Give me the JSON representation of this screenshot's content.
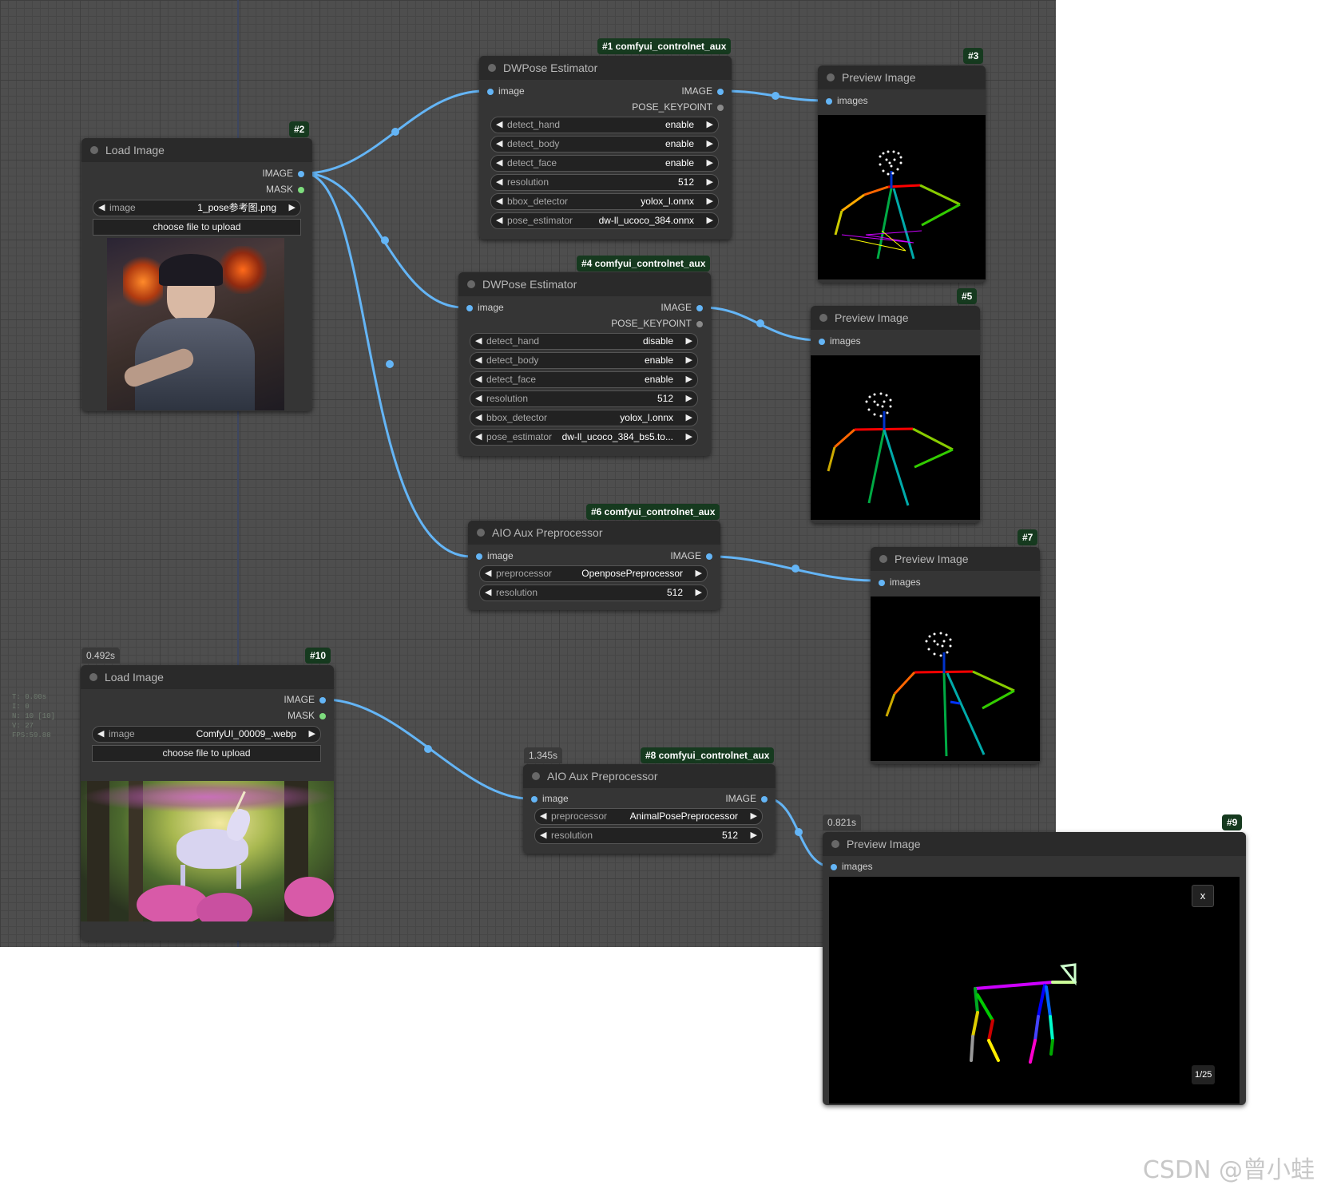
{
  "stats": {
    "t": "T: 0.00s",
    "i": "I: 0",
    "n": "N: 10 [10]",
    "v": "V: 27",
    "fps": "FPS:59.88"
  },
  "nodes": {
    "n1": {
      "badge": "#1 comfyui_controlnet_aux",
      "title": "DWPose Estimator",
      "input": "image",
      "out_image": "IMAGE",
      "out_pose": "POSE_KEYPOINT",
      "widgets": [
        {
          "label": "detect_hand",
          "value": "enable"
        },
        {
          "label": "detect_body",
          "value": "enable"
        },
        {
          "label": "detect_face",
          "value": "enable"
        },
        {
          "label": "resolution",
          "value": "512"
        },
        {
          "label": "bbox_detector",
          "value": "yolox_l.onnx"
        },
        {
          "label": "pose_estimator",
          "value": "dw-ll_ucoco_384.onnx"
        }
      ]
    },
    "n2": {
      "badge": "#2",
      "title": "Load Image",
      "out_image": "IMAGE",
      "out_mask": "MASK",
      "widget": {
        "label": "image",
        "value": "1_pose参考图.png"
      },
      "upload": "choose file to upload"
    },
    "n3": {
      "badge": "#3",
      "title": "Preview Image",
      "input": "images"
    },
    "n4": {
      "badge": "#4 comfyui_controlnet_aux",
      "title": "DWPose Estimator",
      "input": "image",
      "out_image": "IMAGE",
      "out_pose": "POSE_KEYPOINT",
      "widgets": [
        {
          "label": "detect_hand",
          "value": "disable"
        },
        {
          "label": "detect_body",
          "value": "enable"
        },
        {
          "label": "detect_face",
          "value": "enable"
        },
        {
          "label": "resolution",
          "value": "512"
        },
        {
          "label": "bbox_detector",
          "value": "yolox_l.onnx"
        },
        {
          "label": "pose_estimator",
          "value": "dw-ll_ucoco_384_bs5.to..."
        }
      ]
    },
    "n5": {
      "badge": "#5",
      "title": "Preview Image",
      "input": "images"
    },
    "n6": {
      "badge": "#6 comfyui_controlnet_aux",
      "title": "AIO Aux Preprocessor",
      "input": "image",
      "out_image": "IMAGE",
      "widgets": [
        {
          "label": "preprocessor",
          "value": "OpenposePreprocessor"
        },
        {
          "label": "resolution",
          "value": "512"
        }
      ]
    },
    "n7": {
      "badge": "#7",
      "title": "Preview Image",
      "input": "images"
    },
    "n8": {
      "badge": "#8 comfyui_controlnet_aux",
      "time": "1.345s",
      "title": "AIO Aux Preprocessor",
      "input": "image",
      "out_image": "IMAGE",
      "widgets": [
        {
          "label": "preprocessor",
          "value": "AnimalPosePreprocessor"
        },
        {
          "label": "resolution",
          "value": "512"
        }
      ]
    },
    "n9": {
      "badge": "#9",
      "time": "0.821s",
      "title": "Preview Image",
      "input": "images",
      "close": "x",
      "pager": "1/25"
    },
    "n10": {
      "badge": "#10",
      "time": "0.492s",
      "title": "Load Image",
      "out_image": "IMAGE",
      "out_mask": "MASK",
      "widget": {
        "label": "image",
        "value": "ComfyUI_00009_.webp"
      },
      "upload": "choose file to upload"
    }
  },
  "watermark": "CSDN @曾小蛙",
  "colors": {
    "link": "#64b5f6",
    "canvas": "#4e4e4e",
    "node": "#353535",
    "badge": "#163a1f"
  }
}
